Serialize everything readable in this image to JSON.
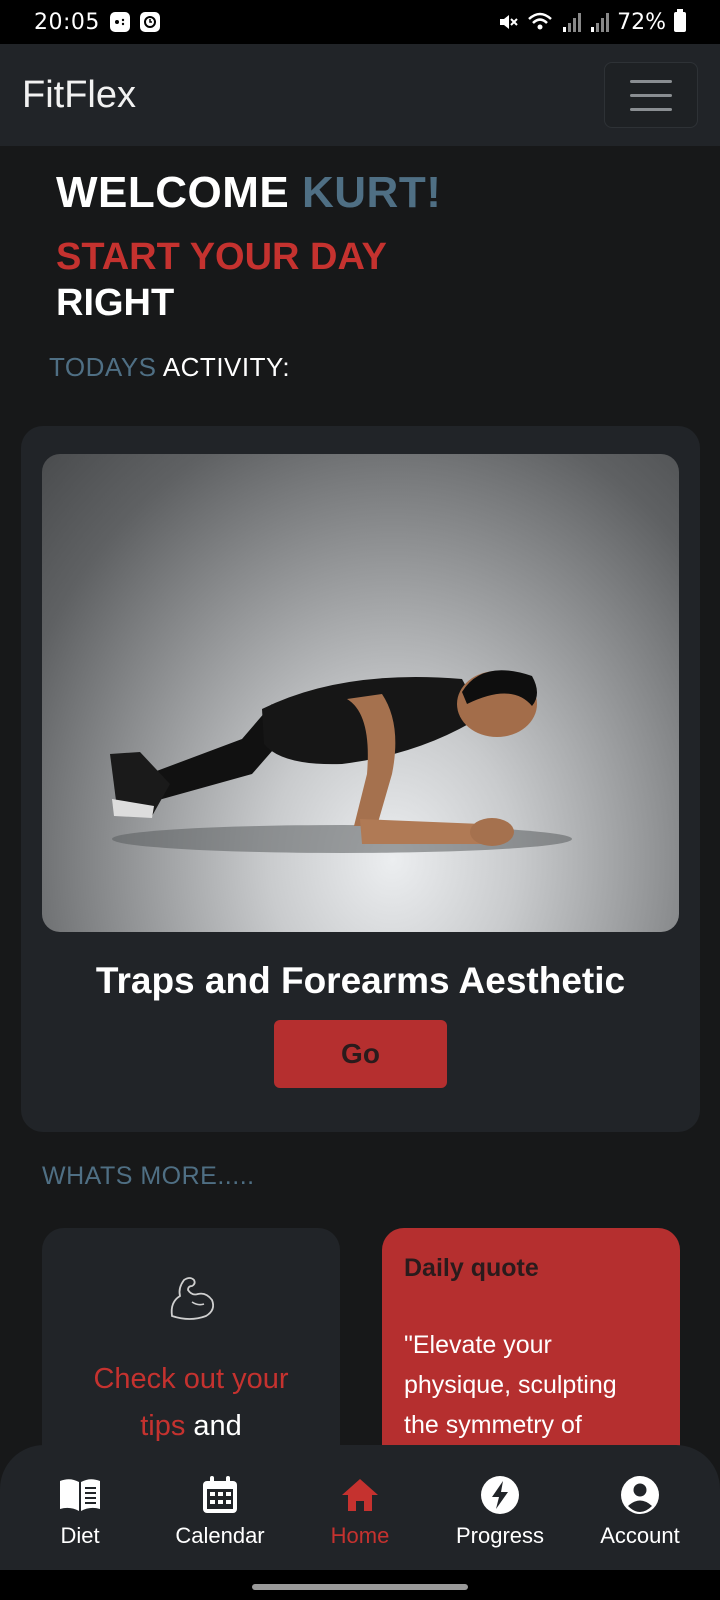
{
  "status_bar": {
    "time": "20:05",
    "battery": "72%",
    "icons": [
      "game-icon",
      "clock-icon",
      "mute-icon",
      "wifi-icon",
      "signal-icon",
      "signal-icon",
      "battery-icon"
    ]
  },
  "navbar": {
    "brand": "FitFlex",
    "menu_icon": "hamburger-icon"
  },
  "greeting": {
    "welcome": "WELCOME",
    "name": "KURT!",
    "tagline_red": "START YOUR DAY",
    "tagline_white": "RIGHT"
  },
  "activity": {
    "label_accent": "TODAYS",
    "label_rest": "ACTIVITY:",
    "title": "Traps and Forearms Aesthetic",
    "button": "Go"
  },
  "whats_more": "WHATS MORE.....",
  "tips": {
    "icon": "flexed-biceps-icon",
    "text_red_1": "Check out your",
    "text_red_2": "tips",
    "text_white": "and"
  },
  "quote": {
    "title": "Daily quote",
    "text": "\"Elevate your physique, sculpting the symmetry of"
  },
  "bottom_nav": [
    {
      "label": "Diet",
      "icon": "book-icon"
    },
    {
      "label": "Calendar",
      "icon": "calendar-icon"
    },
    {
      "label": "Home",
      "icon": "home-icon",
      "active": true
    },
    {
      "label": "Progress",
      "icon": "bolt-icon"
    },
    {
      "label": "Account",
      "icon": "account-icon"
    }
  ],
  "colors": {
    "background": "#171819",
    "surface": "#212428",
    "accent_red": "#c5322f",
    "button_red": "#b52f2f",
    "accent_blue": "#4f6f84"
  }
}
